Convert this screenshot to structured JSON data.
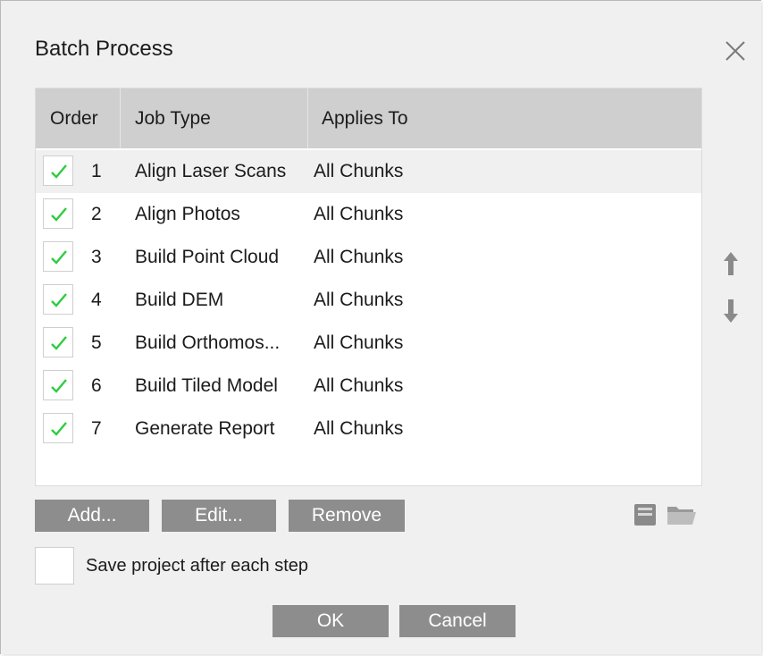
{
  "dialog": {
    "title": "Batch Process"
  },
  "table": {
    "columns": [
      "Order",
      "Job Type",
      "Applies To"
    ],
    "rows": [
      {
        "order": "1",
        "job": "Align Laser Scans",
        "applies": "All Chunks",
        "checked": true
      },
      {
        "order": "2",
        "job": "Align Photos",
        "applies": "All Chunks",
        "checked": true
      },
      {
        "order": "3",
        "job": "Build Point Cloud",
        "applies": "All Chunks",
        "checked": true
      },
      {
        "order": "4",
        "job": "Build DEM",
        "applies": "All Chunks",
        "checked": true
      },
      {
        "order": "5",
        "job": "Build Orthomos...",
        "applies": "All Chunks",
        "checked": true
      },
      {
        "order": "6",
        "job": "Build Tiled Model",
        "applies": "All Chunks",
        "checked": true
      },
      {
        "order": "7",
        "job": "Generate Report",
        "applies": "All Chunks",
        "checked": true
      }
    ]
  },
  "buttons": {
    "add": "Add...",
    "edit": "Edit...",
    "remove": "Remove",
    "ok": "OK",
    "cancel": "Cancel"
  },
  "options": {
    "save_after_each_step": "Save project after each step",
    "save_checked": false
  },
  "icons": {
    "close": "close-icon",
    "move_up": "arrow-up-icon",
    "move_down": "arrow-down-icon",
    "save": "save-icon",
    "open": "folder-icon",
    "check": "checkmark-icon"
  },
  "colors": {
    "check": "#2ecc40",
    "button": "#8d8d8d",
    "header": "#cfcfcf"
  }
}
